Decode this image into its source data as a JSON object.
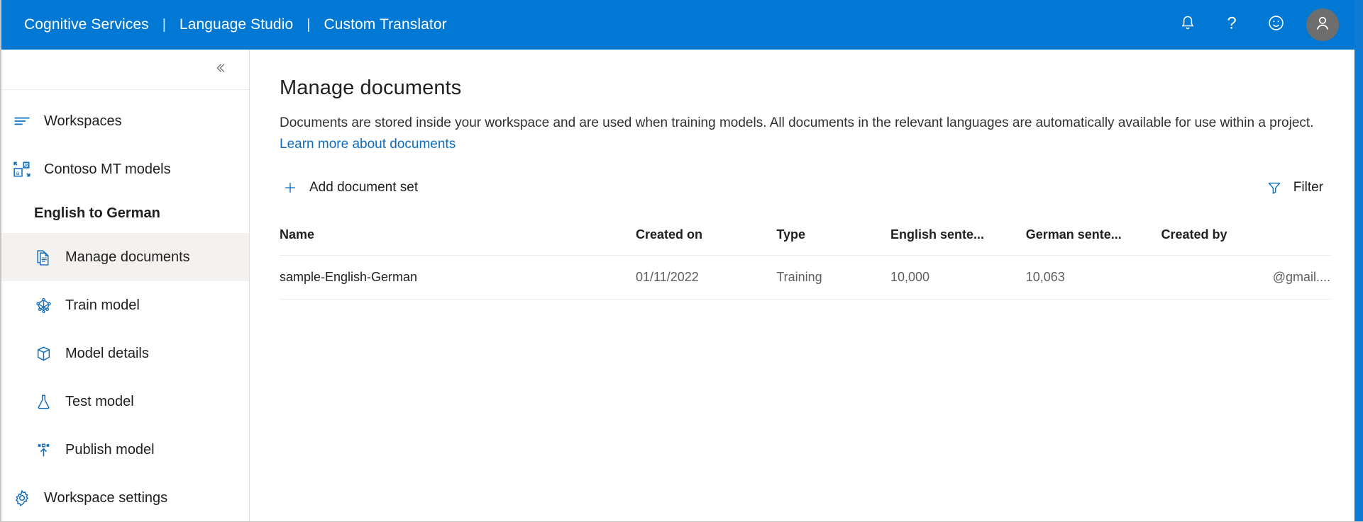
{
  "header": {
    "breadcrumb": [
      {
        "label": "Cognitive Services"
      },
      {
        "label": "Language Studio"
      },
      {
        "label": "Custom Translator"
      }
    ],
    "separator": "|",
    "icons": [
      {
        "name": "notification-bell-icon",
        "glyph": "bell"
      },
      {
        "name": "help-question-icon",
        "glyph": "question"
      },
      {
        "name": "feedback-smiley-icon",
        "glyph": "smiley"
      }
    ],
    "avatar": {
      "name": "user-avatar",
      "glyph": "person"
    },
    "background_color": "#0078d4"
  },
  "sidebar": {
    "collapse_button": {
      "label": "«",
      "name": "collapse-sidebar-button"
    },
    "items": [
      {
        "label": "Workspaces",
        "icon": "list-lines-icon",
        "selected": false,
        "sub": false
      },
      {
        "label": "Contoso MT models",
        "icon": "translate-icon",
        "selected": false,
        "sub": false
      }
    ],
    "section_title": "English to German",
    "project_items": [
      {
        "label": "Manage documents",
        "icon": "document-icon",
        "selected": true
      },
      {
        "label": "Train model",
        "icon": "neural-network-icon",
        "selected": false
      },
      {
        "label": "Model details",
        "icon": "package-box-icon",
        "selected": false
      },
      {
        "label": "Test model",
        "icon": "flask-icon",
        "selected": false
      },
      {
        "label": "Publish model",
        "icon": "publish-upload-icon",
        "selected": false
      }
    ],
    "footer_item": {
      "label": "Workspace settings",
      "icon": "gear-icon",
      "selected": false
    }
  },
  "main": {
    "title": "Manage documents",
    "description_before": "Documents are stored inside your workspace and are used when training models. All documents in the relevant languages are automatically available for use within a project. ",
    "description_link": "Learn more about documents",
    "commands": {
      "add_label": "Add document set",
      "add_icon": "plus-icon",
      "filter_label": "Filter",
      "filter_icon": "filter-funnel-icon"
    },
    "table": {
      "columns": [
        {
          "label": "Name",
          "align": "left"
        },
        {
          "label": "Created on",
          "align": "left"
        },
        {
          "label": "Type",
          "align": "left"
        },
        {
          "label": "English sente...",
          "align": "left"
        },
        {
          "label": "German sente...",
          "align": "left"
        },
        {
          "label": "Created by",
          "align": "left"
        }
      ],
      "rows": [
        {
          "name": "sample-English-German",
          "created_on": "01/11/2022",
          "type": "Training",
          "english_sentences": "10,000",
          "german_sentences": "10,063",
          "created_by": "@gmail...."
        }
      ]
    }
  },
  "colors": {
    "accent": "#0078d4",
    "link": "#0f6cbd",
    "selected_row_bg": "#f3f2f1",
    "text_primary": "#201f1e",
    "text_secondary": "#605e5c"
  }
}
